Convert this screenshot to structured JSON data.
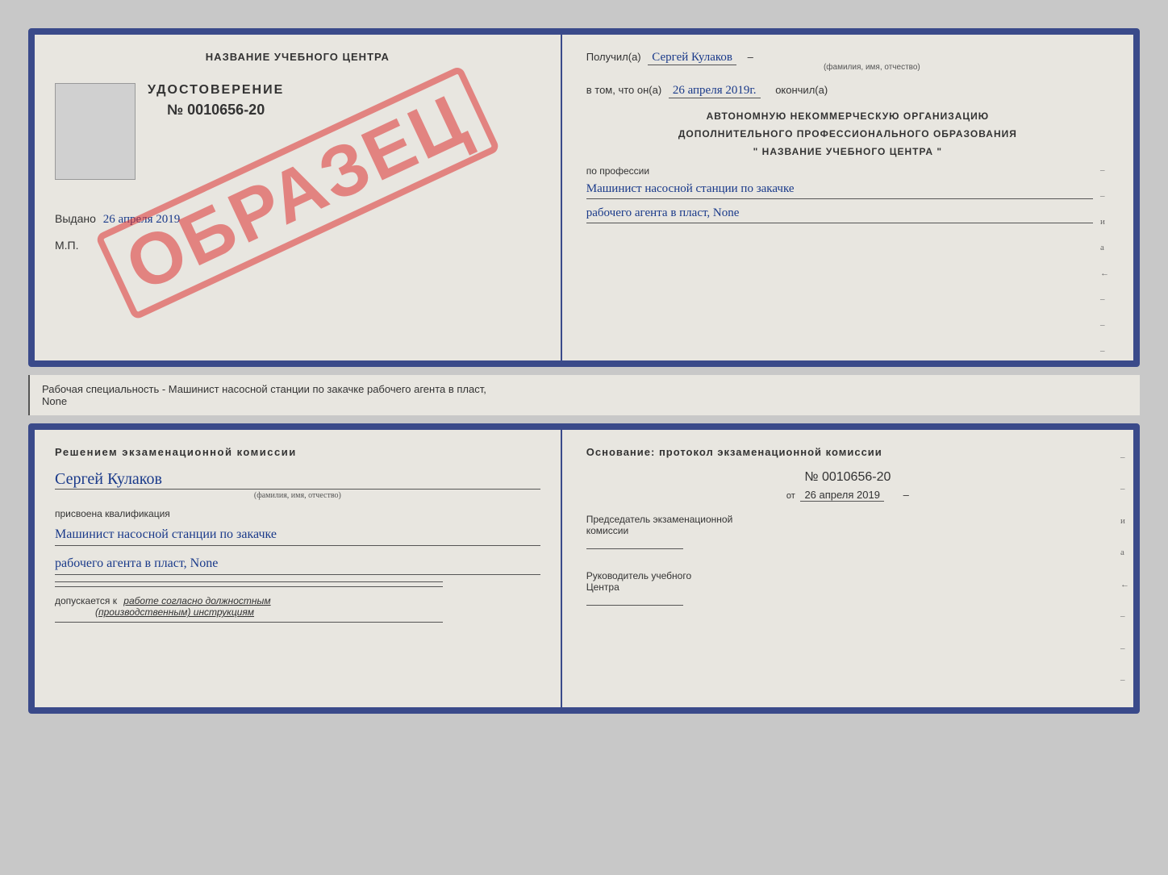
{
  "top_cert": {
    "left": {
      "title": "НАЗВАНИЕ УЧЕБНОГО ЦЕНТРА",
      "photo_placeholder": "",
      "udostoverenie": "УДОСТОВЕРЕНИЕ",
      "number": "№ 0010656-20",
      "vydano_label": "Выдано",
      "vydano_date": "26 апреля 2019",
      "mp": "М.П.",
      "obrazec": "ОБРАЗЕЦ"
    },
    "right": {
      "poluchil_label": "Получил(а)",
      "poluchil_value": "Сергей Кулаков",
      "familiya_label": "(фамилия, имя, отчество)",
      "vtom_label": "в том, что он(а)",
      "vtom_date": "26 апреля 2019г.",
      "okончил_label": "окончил(а)",
      "org_line1": "АВТОНОМНУЮ НЕКОММЕРЧЕСКУЮ ОРГАНИЗАЦИЮ",
      "org_line2": "ДОПОЛНИТЕЛЬНОГО ПРОФЕССИОНАЛЬНОГО ОБРАЗОВАНИЯ",
      "org_line3": "\"   НАЗВАНИЕ УЧЕБНОГО ЦЕНТРА   \"",
      "po_professii": "по профессии",
      "profession_line1": "Машинист насосной станции по закачке",
      "profession_line2": "рабочего агента в пласт, None",
      "i_char": "и",
      "a_char": "а"
    }
  },
  "info_bar": {
    "text": "Рабочая специальность - Машинист насосной станции по закачке рабочего агента в пласт,",
    "text2": "None"
  },
  "bottom_cert": {
    "left": {
      "reshenie_title": "Решением  экзаменационной  комиссии",
      "name_value": "Сергей Кулаков",
      "familiya_label": "(фамилия, имя, отчество)",
      "prisvoena": "присвоена квалификация",
      "qual_line1": "Машинист насосной станции по закачке",
      "qual_line2": "рабочего агента в пласт, None",
      "dopuskaetsya_label": "допускается к",
      "dopuskaetsya_value": "работе согласно должностным",
      "dopuskaetsya_value2": "(производственным) инструкциям",
      "line1": "___________________________",
      "line2": "___________________________"
    },
    "right": {
      "osnovanie_title": "Основание:  протокол  экзаменационной  комиссии",
      "number": "№  0010656-20",
      "ot_label": "от",
      "ot_date": "26 апреля 2019",
      "predsedatel_label": "Председатель экзаменационной",
      "predsedatel_label2": "комиссии",
      "predsedatel_line": "________________",
      "rukovoditel_label": "Руководитель учебного",
      "rukovoditel_label2": "Центра",
      "rukovoditel_line": "________________",
      "i_char": "и",
      "a_char": "а"
    }
  }
}
